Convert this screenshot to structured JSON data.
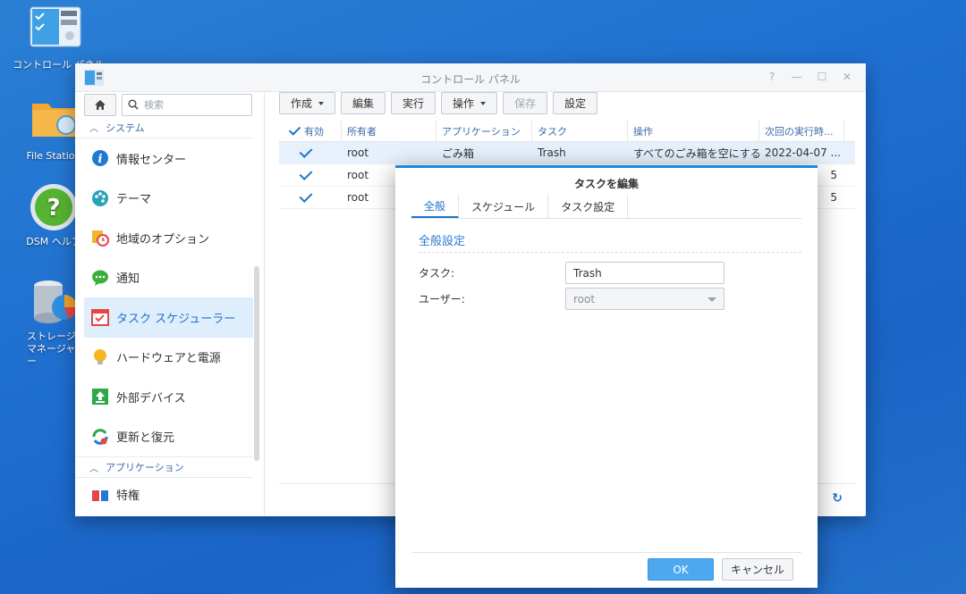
{
  "desktop": {
    "icons": [
      {
        "label": "コントロール パネル",
        "icon": "control-panel-icon"
      },
      {
        "label": "File Station",
        "icon": "folder-search-icon"
      },
      {
        "label": "DSM ヘルプ",
        "icon": "help-icon"
      },
      {
        "label": "ストレージ マネージャー",
        "icon": "storage-manager-icon"
      }
    ]
  },
  "window": {
    "title": "コントロール パネル",
    "controls": [
      "?",
      "—",
      "☐",
      "✕"
    ]
  },
  "sidebar": {
    "search_placeholder": "検索",
    "section_system": "システム",
    "section_apps": "アプリケーション",
    "items": [
      {
        "label": "情報センター",
        "icon": "info-icon"
      },
      {
        "label": "テーマ",
        "icon": "palette-icon"
      },
      {
        "label": "地域のオプション",
        "icon": "clock-map-icon"
      },
      {
        "label": "通知",
        "icon": "chat-bubble-icon"
      },
      {
        "label": "タスク スケジューラー",
        "icon": "calendar-check-icon"
      },
      {
        "label": "ハードウェアと電源",
        "icon": "lightbulb-icon"
      },
      {
        "label": "外部デバイス",
        "icon": "upload-icon"
      },
      {
        "label": "更新と復元",
        "icon": "refresh-icon"
      }
    ],
    "app_items": [
      {
        "label": "特権",
        "icon": "privilege-icon"
      }
    ]
  },
  "toolbar": {
    "create": "作成",
    "edit": "編集",
    "run": "実行",
    "action": "操作",
    "save": "保存",
    "settings": "設定"
  },
  "grid": {
    "headers": [
      "有効",
      "所有者",
      "アプリケーション",
      "タスク",
      "操作",
      "次回の実行時..."
    ],
    "rows": [
      {
        "enabled": true,
        "owner": "root",
        "app": "ごみ箱",
        "task": "Trash",
        "action": "すべてのごみ箱を空にする",
        "next": "2022-04-07 ..."
      },
      {
        "enabled": true,
        "owner": "root",
        "app": "",
        "task": "",
        "action": "",
        "next": "5"
      },
      {
        "enabled": true,
        "owner": "root",
        "app": "",
        "task": "",
        "action": "",
        "next": "5"
      }
    ]
  },
  "dialog": {
    "title": "タスクを編集",
    "tabs": [
      "全般",
      "スケジュール",
      "タスク設定"
    ],
    "section_title": "全般設定",
    "task_label": "タスク:",
    "task_value": "Trash",
    "user_label": "ユーザー:",
    "user_value": "root",
    "ok": "OK",
    "cancel": "キャンセル"
  },
  "colors": {
    "accent": "#1e73c8",
    "desktop": "#1f6fd0"
  }
}
